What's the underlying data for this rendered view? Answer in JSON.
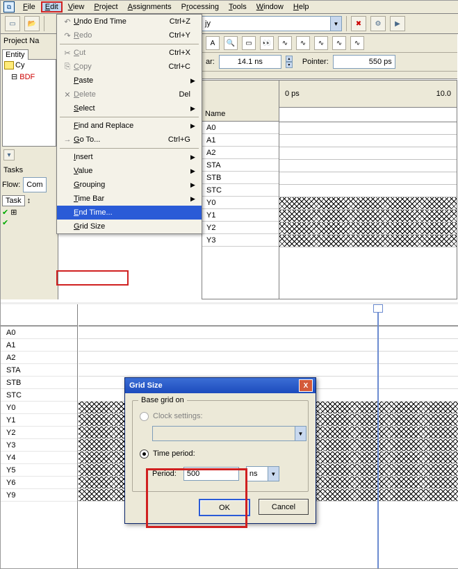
{
  "menubar": {
    "items": [
      "File",
      "Edit",
      "View",
      "Project",
      "Assignments",
      "Processing",
      "Tools",
      "Window",
      "Help"
    ]
  },
  "leftpane": {
    "project_nav": "Project Na",
    "entity_tab": "Entity",
    "cy_node": "Cy",
    "tasks_label": "Tasks",
    "flow_label": "Flow:",
    "flow_value": "Com",
    "task_tab": "Task"
  },
  "edit_menu": [
    {
      "ic": "↶",
      "label": "Undo End Time",
      "shortcut": "Ctrl+Z",
      "dis": false,
      "sub": false
    },
    {
      "ic": "↷",
      "label": "Redo",
      "shortcut": "Ctrl+Y",
      "dis": true,
      "sub": false
    },
    {
      "sep": true
    },
    {
      "ic": "✂",
      "label": "Cut",
      "shortcut": "Ctrl+X",
      "dis": true,
      "sub": false
    },
    {
      "ic": "⎘",
      "label": "Copy",
      "shortcut": "Ctrl+C",
      "dis": true,
      "sub": false
    },
    {
      "ic": "",
      "label": "Paste",
      "shortcut": "",
      "dis": false,
      "sub": true
    },
    {
      "ic": "✕",
      "label": "Delete",
      "shortcut": "Del",
      "dis": true,
      "sub": false
    },
    {
      "ic": "",
      "label": "Select",
      "shortcut": "",
      "dis": false,
      "sub": true
    },
    {
      "sep": true
    },
    {
      "ic": "",
      "label": "Find and Replace",
      "shortcut": "",
      "dis": false,
      "sub": true
    },
    {
      "ic": "→",
      "label": "Go To...",
      "shortcut": "Ctrl+G",
      "dis": false,
      "sub": false
    },
    {
      "sep": true
    },
    {
      "ic": "",
      "label": "Insert",
      "shortcut": "",
      "dis": false,
      "sub": true
    },
    {
      "ic": "",
      "label": "Value",
      "shortcut": "",
      "dis": false,
      "sub": true
    },
    {
      "ic": "",
      "label": "Grouping",
      "shortcut": "",
      "dis": false,
      "sub": true
    },
    {
      "ic": "",
      "label": "Time Bar",
      "shortcut": "",
      "dis": false,
      "sub": true
    },
    {
      "ic": "",
      "label": "End Time...",
      "shortcut": "",
      "dis": false,
      "sub": false,
      "sel": true
    },
    {
      "ic": "",
      "label": "Grid Size",
      "shortcut": "",
      "dis": false,
      "sub": false
    }
  ],
  "toolbar": {
    "project_combo": "jy",
    "bar_label": "ar:",
    "bar_value": "14.1 ns",
    "pointer_label": "Pointer:",
    "pointer_value": "550 ps"
  },
  "wave": {
    "name_header": "Name",
    "time_left": "0 ps",
    "time_right": "10.0",
    "signals": [
      "A0",
      "A1",
      "A2",
      "STA",
      "STB",
      "STC",
      "Y0",
      "Y1",
      "Y2",
      "Y3"
    ],
    "hatched": [
      "Y0",
      "Y1",
      "Y2",
      "Y3"
    ]
  },
  "bottom": {
    "signals": [
      "A0",
      "A1",
      "A2",
      "STA",
      "STB",
      "STC",
      "Y0",
      "Y1",
      "Y2",
      "Y3",
      "Y4",
      "Y5",
      "Y6",
      "Y9"
    ],
    "hatched": [
      "Y0",
      "Y1",
      "Y2",
      "Y3",
      "Y4",
      "Y5",
      "Y6",
      "Y9"
    ]
  },
  "dialog": {
    "title": "Grid Size",
    "group": "Base grid on",
    "opt_clock": "Clock settings:",
    "opt_time": "Time period:",
    "period_label": "Period:",
    "period_value": "500",
    "unit": "ns",
    "ok": "OK",
    "cancel": "Cancel"
  }
}
